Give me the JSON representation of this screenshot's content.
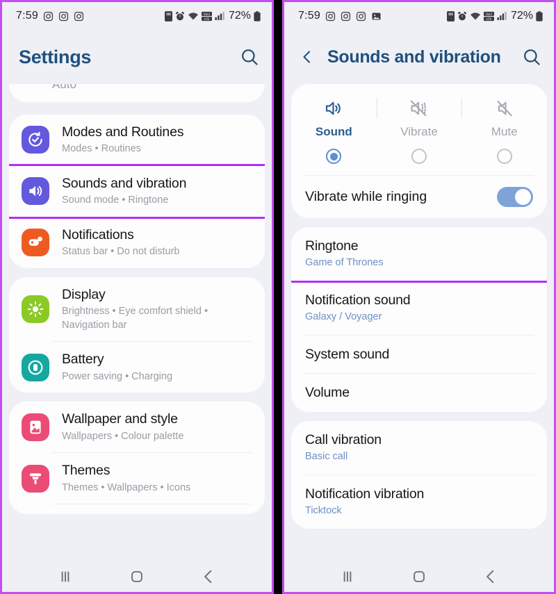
{
  "status_bar": {
    "time": "7:59",
    "battery_percent": "72%",
    "left_icons": [
      "instagram-icon",
      "instagram-icon",
      "instagram-icon"
    ],
    "left_icons_right_panel": [
      "instagram-icon",
      "instagram-icon",
      "instagram-icon",
      "gallery-icon"
    ],
    "right_icons": [
      "sd-card-icon",
      "alarm-icon",
      "wifi-icon",
      "volte-icon",
      "signal-icon",
      "battery-icon"
    ]
  },
  "colors": {
    "highlight": "#b42ff0",
    "title": "#20507e",
    "accent_blue": "#6f90c4",
    "toggle_on": "#7da3d8"
  },
  "left_panel": {
    "header": {
      "title": "Settings",
      "search_icon": "search-icon"
    },
    "cut_card_label": "Auto",
    "groups": [
      {
        "items": [
          {
            "title": "Modes and Routines",
            "subtitle": "Modes  •  Routines",
            "icon": "modes-routines-icon",
            "icon_color": "#6259dd",
            "highlighted": false
          },
          {
            "title": "Sounds and vibration",
            "subtitle": "Sound mode  •  Ringtone",
            "icon": "speaker-icon",
            "icon_color": "#6259dd",
            "highlighted": true
          },
          {
            "title": "Notifications",
            "subtitle": "Status bar  •  Do not disturb",
            "icon": "notifications-icon",
            "icon_color": "#ef5a20",
            "highlighted": false
          }
        ]
      },
      {
        "items": [
          {
            "title": "Display",
            "subtitle": "Brightness  •  Eye comfort shield  •  Navigation bar",
            "icon": "brightness-icon",
            "icon_color": "#8bc925",
            "highlighted": false
          },
          {
            "title": "Battery",
            "subtitle": "Power saving  •  Charging",
            "icon": "battery-settings-icon",
            "icon_color": "#14a8a0",
            "highlighted": false
          }
        ]
      },
      {
        "items": [
          {
            "title": "Wallpaper and style",
            "subtitle": "Wallpapers  •  Colour palette",
            "icon": "wallpaper-icon",
            "icon_color": "#ea4c76",
            "highlighted": false
          },
          {
            "title": "Themes",
            "subtitle": "Themes  •  Wallpapers  •  Icons",
            "icon": "themes-brush-icon",
            "icon_color": "#ea4c76",
            "highlighted": false
          }
        ]
      }
    ]
  },
  "right_panel": {
    "header": {
      "back_icon": "back-chevron-icon",
      "title": "Sounds and vibration",
      "search_icon": "search-icon"
    },
    "sound_mode": {
      "options": [
        {
          "label": "Sound",
          "icon": "sound-on-icon",
          "selected": true
        },
        {
          "label": "Vibrate",
          "icon": "vibrate-icon",
          "selected": false
        },
        {
          "label": "Mute",
          "icon": "mute-icon",
          "selected": false
        }
      ],
      "vibrate_while_ringing": {
        "label": "Vibrate while ringing",
        "enabled": true
      }
    },
    "groups": [
      {
        "items": [
          {
            "title": "Ringtone",
            "subtitle": "Game of Thrones",
            "highlighted": true
          },
          {
            "title": "Notification sound",
            "subtitle": "Galaxy / Voyager",
            "highlighted": false
          },
          {
            "title": "System sound",
            "subtitle": "",
            "highlighted": false
          },
          {
            "title": "Volume",
            "subtitle": "",
            "highlighted": false
          }
        ]
      },
      {
        "items": [
          {
            "title": "Call vibration",
            "subtitle": "Basic call",
            "highlighted": false
          },
          {
            "title": "Notification vibration",
            "subtitle": "Ticktock",
            "highlighted": false
          }
        ]
      }
    ]
  },
  "nav_bar": {
    "recents": "recents-icon",
    "home": "home-icon",
    "back": "back-icon"
  }
}
